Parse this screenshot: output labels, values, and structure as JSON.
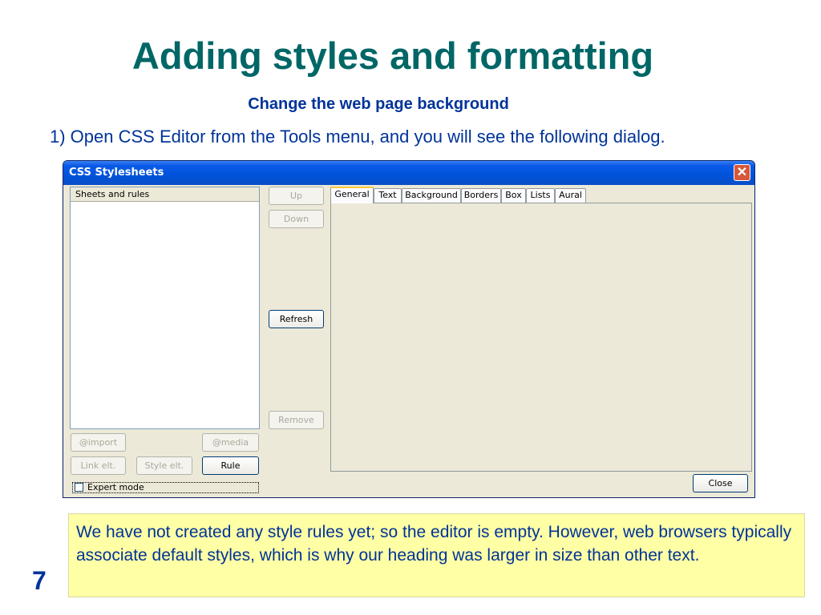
{
  "slide": {
    "title": "Adding styles and formatting",
    "subtitle": "Change the web page background",
    "instruction": "1) Open CSS Editor from the Tools menu, and you will see the following dialog.",
    "note": "We have not created any style rules yet; so the editor is empty. However, web browsers typically associate default styles, which is why our heading was larger in size than other text.",
    "page_number": "7"
  },
  "dialog": {
    "title": "CSS Stylesheets",
    "close_glyph": "✕",
    "tree_header": "Sheets and rules",
    "buttons": {
      "up": "Up",
      "down": "Down",
      "refresh": "Refresh",
      "remove": "Remove",
      "import": "@import",
      "media": "@media",
      "link_elt": "Link elt.",
      "style_elt": "Style elt.",
      "rule": "Rule",
      "close": "Close"
    },
    "expert_mode_label": "Expert mode",
    "expert_mode_checked": false,
    "tabs": [
      "General",
      "Text",
      "Background",
      "Borders",
      "Box",
      "Lists",
      "Aural"
    ],
    "active_tab": "General"
  },
  "colors": {
    "title": "#006666",
    "body_text": "#003399",
    "note_background": "#ffffa5",
    "titlebar": "#0052d9"
  }
}
